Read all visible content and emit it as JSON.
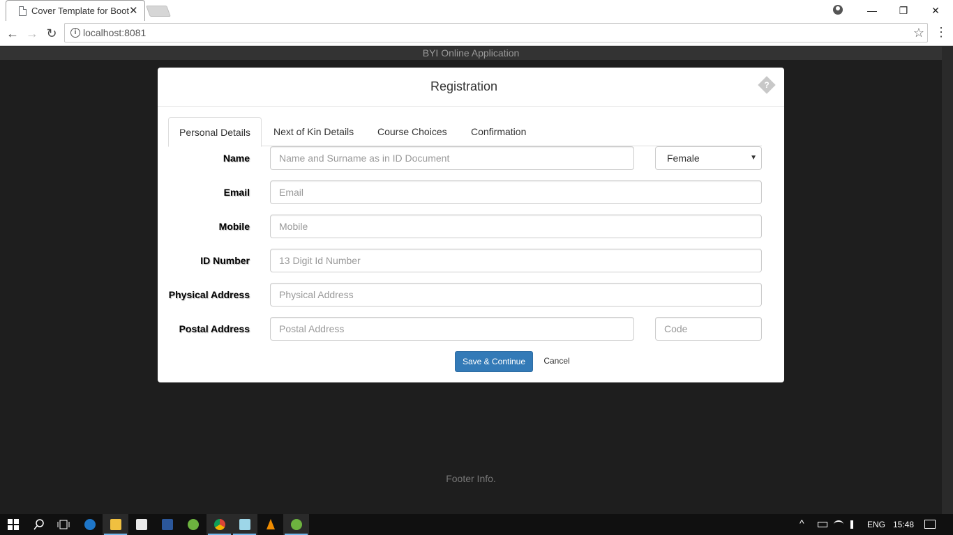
{
  "browser": {
    "tab_title": "Cover Template for Bootstrap",
    "tab_close": "✕",
    "url": "localhost:8081",
    "icons": {
      "back": "←",
      "forward": "→",
      "reload": "↻",
      "star": "☆",
      "menu": "⋮",
      "minimize": "—",
      "restore": "❐",
      "close": "✕",
      "info": "i"
    }
  },
  "page": {
    "site_title": "BYI Online Application",
    "footer": "Footer Info."
  },
  "modal": {
    "title": "Registration",
    "help_glyph": "?",
    "tabs": [
      "Personal Details",
      "Next of Kin Details",
      "Course Choices",
      "Confirmation"
    ],
    "active_tab": 0,
    "fields": {
      "name": {
        "label": "Name",
        "placeholder": "Name and Surname as in ID Document",
        "value": ""
      },
      "gender": {
        "selected": "Female",
        "caret": "▼"
      },
      "email": {
        "label": "Email",
        "placeholder": "Email",
        "value": ""
      },
      "mobile": {
        "label": "Mobile",
        "placeholder": "Mobile",
        "value": ""
      },
      "id_number": {
        "label": "ID Number",
        "placeholder": "13 Digit Id Number",
        "value": ""
      },
      "physical_address": {
        "label": "Physical Address",
        "placeholder": "Physical Address",
        "value": ""
      },
      "postal_address": {
        "label": "Postal Address",
        "placeholder": "Postal Address",
        "value": ""
      },
      "postal_code": {
        "placeholder": "Code",
        "value": ""
      }
    },
    "buttons": {
      "save": "Save & Continue",
      "cancel": "Cancel"
    }
  },
  "taskbar": {
    "apps": [
      "start",
      "search",
      "task-view",
      "edge",
      "file-explorer",
      "store",
      "word",
      "spring-tool",
      "chrome",
      "notepad",
      "vlc",
      "spring-tool-2"
    ],
    "tray": {
      "language": "ENG",
      "time": "15:48",
      "chevron": "^"
    },
    "colors": {
      "edge": "#1e76c8",
      "explorer": "#f0c040",
      "word": "#2b579a",
      "spring": "#6db33f",
      "chrome": "#db4437",
      "vlc": "#f08c00"
    }
  }
}
